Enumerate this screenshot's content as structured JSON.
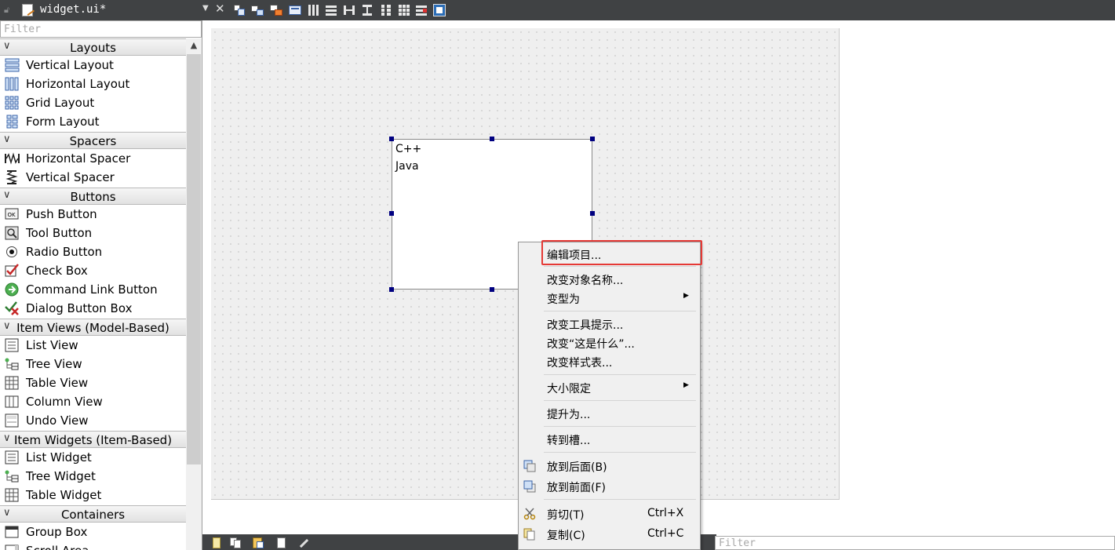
{
  "colors": {
    "toolbar_bg": "#404244",
    "selection_handle": "#000080",
    "highlight_border": "#e53935"
  },
  "tab": {
    "title": "widget.ui*"
  },
  "toolbar_icons": [
    "edit-widgets-icon",
    "edit-signals-slots-icon",
    "edit-buddies-icon",
    "edit-tab-order-icon",
    "layout-horizontal-icon",
    "layout-vertical-icon",
    "layout-horizontal-splitter-icon",
    "layout-vertical-splitter-icon",
    "layout-form-icon",
    "layout-grid-icon",
    "break-layout-icon",
    "adjust-size-icon"
  ],
  "sidebar": {
    "filter_placeholder": "Filter",
    "categories": {
      "layouts": "Layouts",
      "spacers": "Spacers",
      "buttons": "Buttons",
      "item_views": "Item Views (Model-Based)",
      "item_widgets": "Item Widgets (Item-Based)",
      "containers": "Containers"
    },
    "items": {
      "vertical_layout": "Vertical Layout",
      "horizontal_layout": "Horizontal Layout",
      "grid_layout": "Grid Layout",
      "form_layout": "Form Layout",
      "horizontal_spacer": "Horizontal Spacer",
      "vertical_spacer": "Vertical Spacer",
      "push_button": "Push Button",
      "tool_button": "Tool Button",
      "radio_button": "Radio Button",
      "check_box": "Check Box",
      "command_link_button": "Command Link Button",
      "dialog_button_box": "Dialog Button Box",
      "list_view": "List View",
      "tree_view": "Tree View",
      "table_view": "Table View",
      "column_view": "Column View",
      "undo_view": "Undo View",
      "list_widget": "List Widget",
      "tree_widget": "Tree Widget",
      "table_widget": "Table Widget",
      "group_box": "Group Box",
      "scroll_area": "Scroll Area"
    }
  },
  "form": {
    "list_items": [
      "C++",
      "Java"
    ]
  },
  "context_menu": {
    "edit_items": "编辑项目...",
    "change_object_name": "改变对象名称...",
    "morph_into": "变型为",
    "change_tooltip": "改变工具提示...",
    "change_whats_this": "改变“这是什么”...",
    "change_stylesheet": "改变样式表...",
    "size_constraints": "大小限定",
    "promote_to": "提升为...",
    "go_to_slot": "转到槽...",
    "send_to_back": "放到后面(B)",
    "bring_to_front": "放到前面(F)",
    "cut": "剪切(T)",
    "cut_shortcut": "Ctrl+X",
    "copy": "复制(C)",
    "copy_shortcut": "Ctrl+C"
  },
  "bottom": {
    "filter_placeholder": "Filter"
  }
}
